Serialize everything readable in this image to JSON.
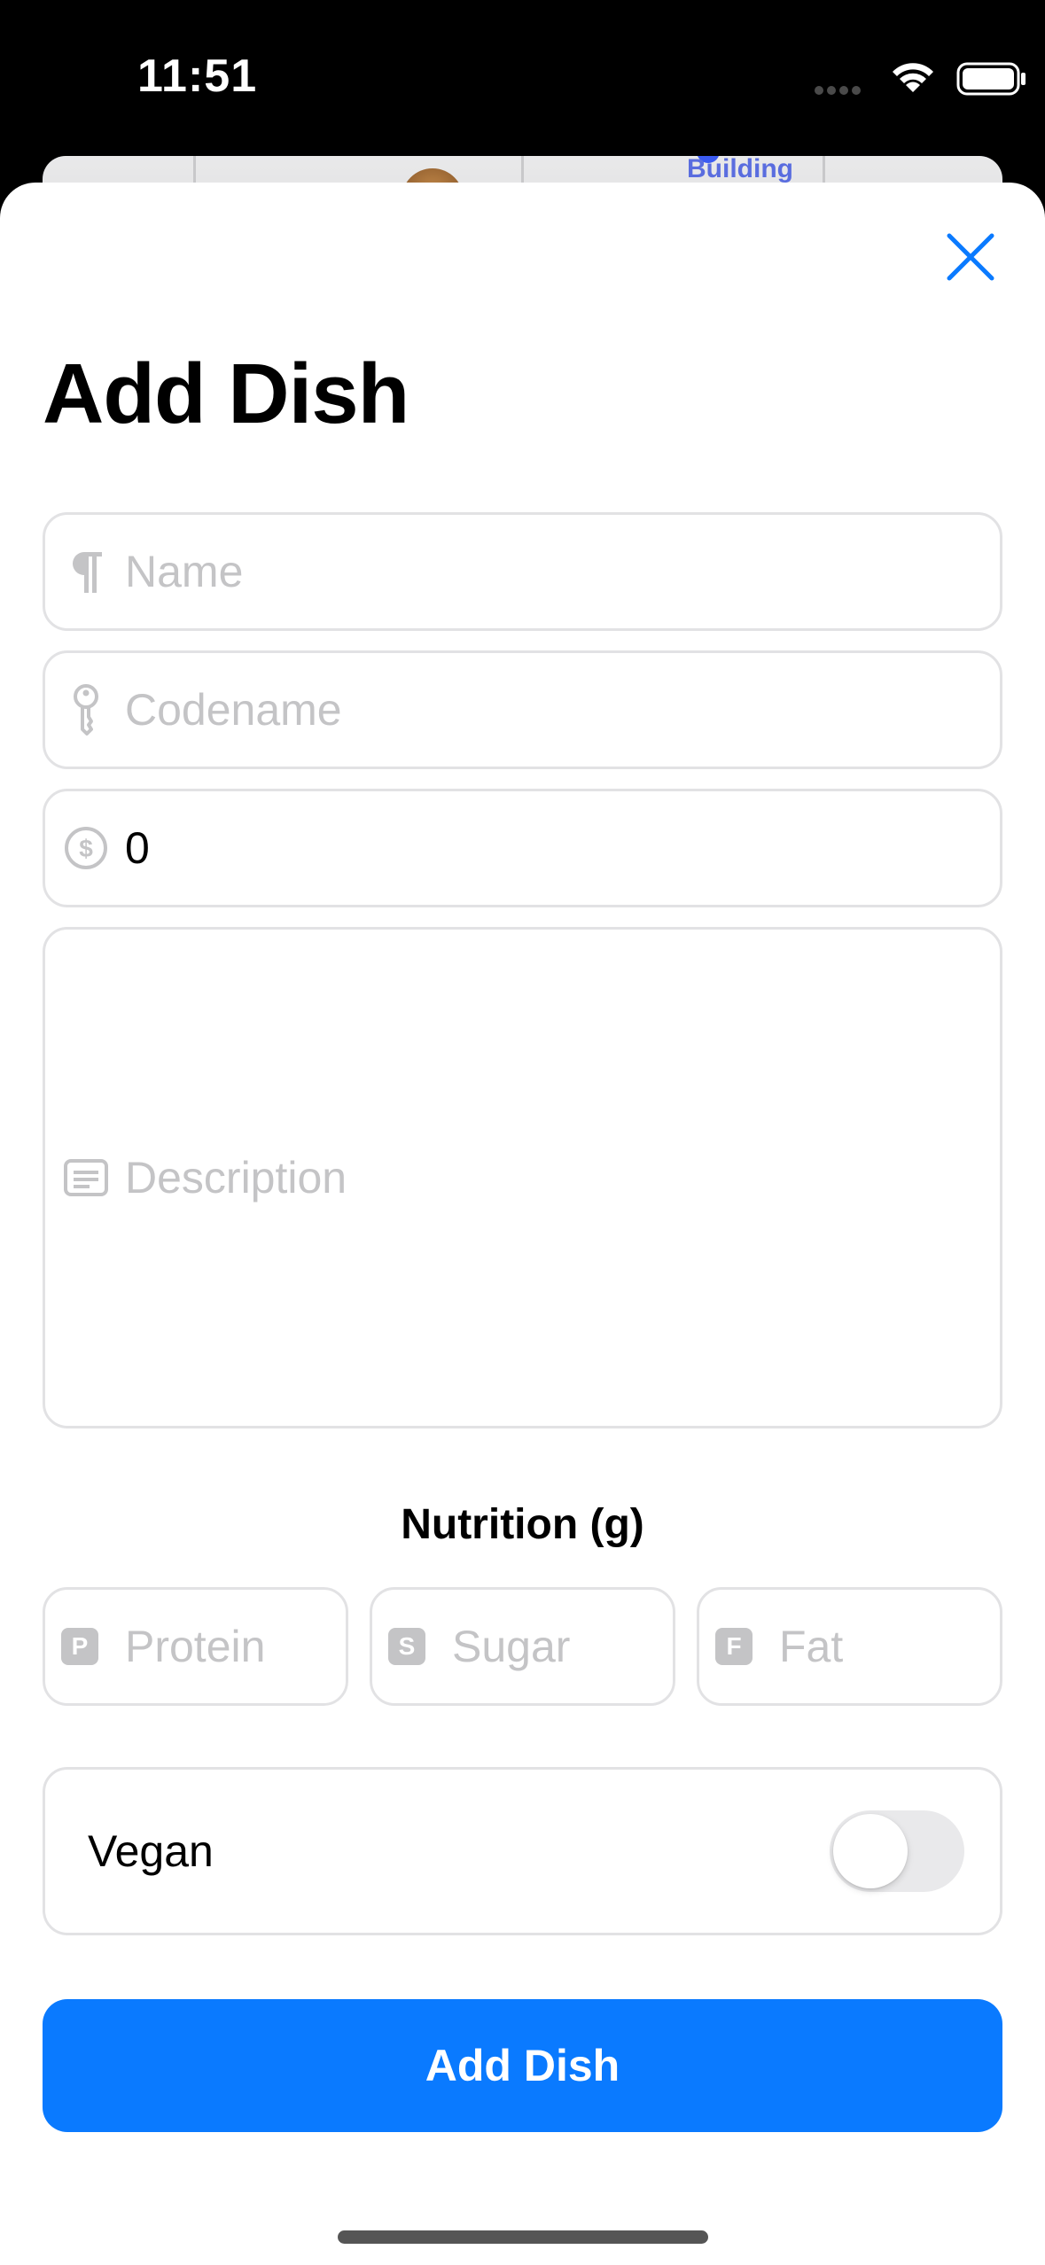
{
  "status_bar": {
    "time": "11:51"
  },
  "background": {
    "map_label": "Building"
  },
  "sheet": {
    "title": "Add Dish",
    "fields": {
      "name": {
        "placeholder": "Name",
        "icon": "paragraph-icon"
      },
      "codename": {
        "placeholder": "Codename",
        "icon": "key-icon"
      },
      "price": {
        "value": "0",
        "icon": "dollar-circle-icon"
      },
      "description": {
        "placeholder": "Description",
        "icon": "text-box-icon"
      }
    },
    "nutrition": {
      "title": "Nutrition (g)",
      "protein": {
        "badge": "P",
        "placeholder": "Protein"
      },
      "sugar": {
        "badge": "S",
        "placeholder": "Sugar"
      },
      "fat": {
        "badge": "F",
        "placeholder": "Fat"
      }
    },
    "vegan": {
      "label": "Vegan",
      "enabled": false
    },
    "submit_label": "Add Dish"
  },
  "colors": {
    "accent": "#0a7aff",
    "placeholder": "#c4c4c6",
    "border": "#e2e2e4"
  }
}
